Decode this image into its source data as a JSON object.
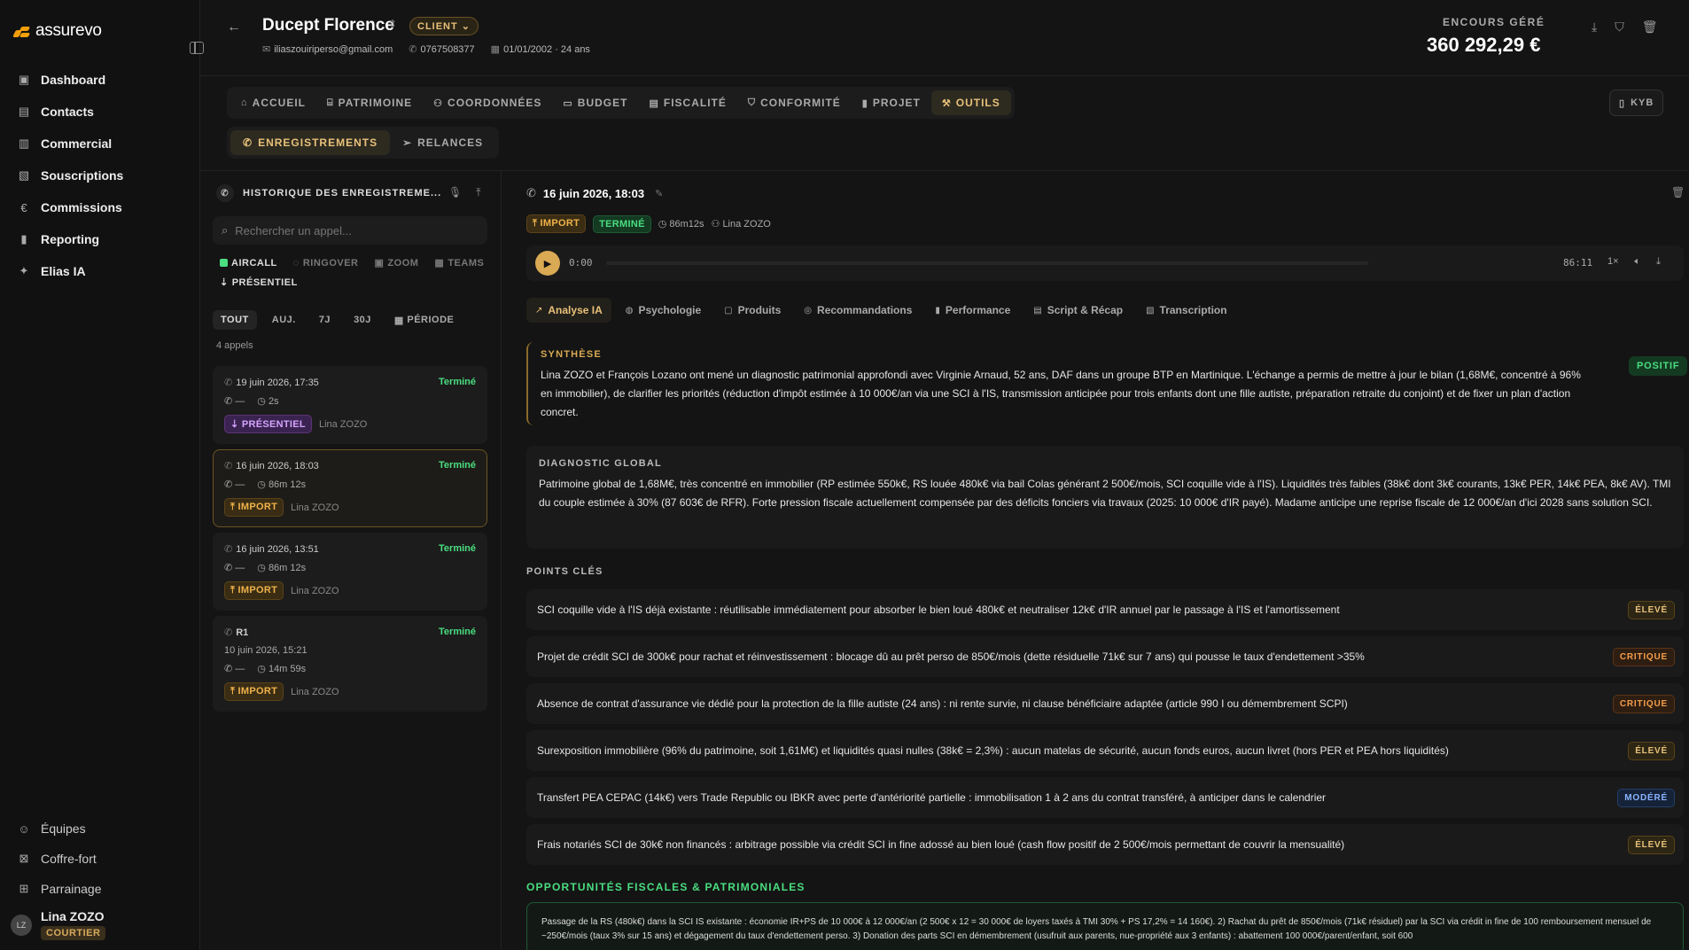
{
  "brand": {
    "name": "assurevo"
  },
  "nav": {
    "items": [
      {
        "label": "Dashboard",
        "icon": "dashboard-icon"
      },
      {
        "label": "Contacts",
        "icon": "contacts-icon"
      },
      {
        "label": "Commercial",
        "icon": "building-icon"
      },
      {
        "label": "Souscriptions",
        "icon": "document-icon"
      },
      {
        "label": "Commissions",
        "icon": "euro-icon"
      },
      {
        "label": "Reporting",
        "icon": "bar-chart-icon"
      },
      {
        "label": "Elias IA",
        "icon": "sparkle-icon"
      }
    ],
    "bottom": [
      {
        "label": "Équipes",
        "icon": "users-icon"
      },
      {
        "label": "Coffre-fort",
        "icon": "vault-icon"
      },
      {
        "label": "Parrainage",
        "icon": "gift-icon"
      }
    ]
  },
  "user": {
    "initials": "LZ",
    "name": "Lina ZOZO",
    "role": "COURTIER"
  },
  "client": {
    "name": "Ducept Florence",
    "badge": "CLIENT",
    "email": "iliaszouiriperso@gmail.com",
    "phone": "0767508377",
    "birth": "01/01/2002 · 24 ans"
  },
  "encours": {
    "label": "ENCOURS GÉRÉ",
    "value": "360 292,29 €"
  },
  "tabs": [
    "ACCUEIL",
    "PATRIMOINE",
    "COORDONNÉES",
    "BUDGET",
    "FISCALITÉ",
    "CONFORMITÉ",
    "PROJET",
    "OUTILS"
  ],
  "active_tab": "OUTILS",
  "kyb_label": "KYB",
  "subtabs": [
    "ENREGISTREMENTS",
    "RELANCES"
  ],
  "history": {
    "title": "HISTORIQUE DES ENREGISTREME...",
    "search_placeholder": "Rechercher un appel...",
    "sources": [
      "AIRCALL",
      "RINGOVER",
      "ZOOM",
      "TEAMS",
      "PRÉSENTIEL"
    ],
    "filters": [
      "TOUT",
      "AUJ.",
      "7J",
      "30J",
      "PÉRIODE"
    ],
    "count": "4 appels",
    "calls": [
      {
        "date": "19 juin 2026, 17:35",
        "status": "Terminé",
        "dash": "—",
        "duration": "2s",
        "tag": "PRÉSENTIEL",
        "agent": "Lina ZOZO"
      },
      {
        "date": "16 juin 2026, 18:03",
        "status": "Terminé",
        "dash": "—",
        "duration": "86m 12s",
        "tag": "IMPORT",
        "agent": "Lina ZOZO"
      },
      {
        "date": "16 juin 2026, 13:51",
        "status": "Terminé",
        "dash": "—",
        "duration": "86m 12s",
        "tag": "IMPORT",
        "agent": "Lina ZOZO"
      },
      {
        "date": "R1",
        "sub": "10 juin 2026, 15:21",
        "status": "Terminé",
        "dash": "—",
        "duration": "14m 59s",
        "tag": "IMPORT",
        "agent": "Lina ZOZO"
      }
    ]
  },
  "recording": {
    "title": "16 juin 2026, 18:03",
    "tag_import": "IMPORT",
    "tag_status": "TERMINÉ",
    "duration": "86m12s",
    "agent": "Lina ZOZO",
    "time_start": "0:00",
    "time_end": "86:11",
    "speed": "1×"
  },
  "analysis_tabs": [
    "Analyse IA",
    "Psychologie",
    "Produits",
    "Recommandations",
    "Performance",
    "Script & Récap",
    "Transcription"
  ],
  "synthese": {
    "label": "SYNTHÈSE",
    "badge": "POSITIF",
    "text": "Lina ZOZO et François Lozano ont mené un diagnostic patrimonial approfondi avec Virginie Arnaud, 52 ans, DAF dans un groupe BTP en Martinique. L'échange a permis de mettre à jour le bilan (1,68M€, concentré à 96% en immobilier), de clarifier les priorités (réduction d'impôt estimée à 10 000€/an via une SCI à l'IS, transmission anticipée pour trois enfants dont une fille autiste, préparation retraite du conjoint) et de fixer un plan d'action concret."
  },
  "diagnostic": {
    "label": "DIAGNOSTIC GLOBAL",
    "text": "Patrimoine global de 1,68M€, très concentré en immobilier (RP estimée 550k€, RS louée 480k€ via bail Colas générant 2 500€/mois, SCI coquille vide à l'IS). Liquidités très faibles (38k€ dont 3k€ courants, 13k€ PER, 14k€ PEA, 8k€ AV). TMI du couple estimée à 30% (87 603€ de RFR). Forte pression fiscale actuellement compensée par des déficits fonciers via travaux (2025: 10 000€ d'IR payé). Madame anticipe une reprise fiscale de 12 000€/an d'ici 2028 sans solution SCI."
  },
  "points_label": "POINTS CLÉS",
  "points": [
    {
      "text": "SCI coquille vide à l'IS déjà existante : réutilisable immédiatement pour absorber le bien loué 480k€ et neutraliser 12k€ d'IR annuel par le passage à l'IS et l'amortissement",
      "level": "ÉLEVÉ",
      "kind": "eleve"
    },
    {
      "text": "Projet de crédit SCI de 300k€ pour rachat et réinvestissement : blocage dû au prêt perso de 850€/mois (dette résiduelle 71k€ sur 7 ans) qui pousse le taux d'endettement >35%",
      "level": "CRITIQUE",
      "kind": "critique"
    },
    {
      "text": "Absence de contrat d'assurance vie dédié pour la protection de la fille autiste (24 ans) : ni rente survie, ni clause bénéficiaire adaptée (article 990 I ou démembrement SCPI)",
      "level": "CRITIQUE",
      "kind": "critique"
    },
    {
      "text": "Surexposition immobilière (96% du patrimoine, soit 1,61M€) et liquidités quasi nulles (38k€ = 2,3%) : aucun matelas de sécurité, aucun fonds euros, aucun livret (hors PER et PEA hors liquidités)",
      "level": "ÉLEVÉ",
      "kind": "eleve"
    },
    {
      "text": "Transfert PEA CEPAC (14k€) vers Trade Republic ou IBKR avec perte d'antériorité partielle : immobilisation 1 à 2 ans du contrat transféré, à anticiper dans le calendrier",
      "level": "MODÉRÉ",
      "kind": "modere"
    },
    {
      "text": "Frais notariés SCI de 30k€ non financés : arbitrage possible via crédit SCI in fine adossé au bien loué (cash flow positif de 2 500€/mois permettant de couvrir la mensualité)",
      "level": "ÉLEVÉ",
      "kind": "eleve"
    }
  ],
  "opportunities": {
    "label": "OPPORTUNITÉS FISCALES & PATRIMONIALES",
    "text": "Passage de la RS (480k€) dans la SCI IS existante : économie IR+PS de 10 000€ à 12 000€/an (2 500€ x 12 = 30 000€ de loyers taxés à TMI 30% + PS 17,2% = 14 160€). 2) Rachat du prêt de 850€/mois (71k€ résiduel) par la SCI via crédit in fine de 100 remboursement mensuel de ~250€/mois (taux 3% sur 15 ans) et dégagement du taux d'endettement perso. 3) Donation des parts SCI en démembrement (usufruit aux parents, nue-propriété aux 3 enfants) : abattement 100 000€/parent/enfant, soit 600"
  },
  "colors": {
    "accent": "#d9a953",
    "success": "#4ade80",
    "critical": "#f59e4a",
    "moderate": "#8ab4ff"
  }
}
